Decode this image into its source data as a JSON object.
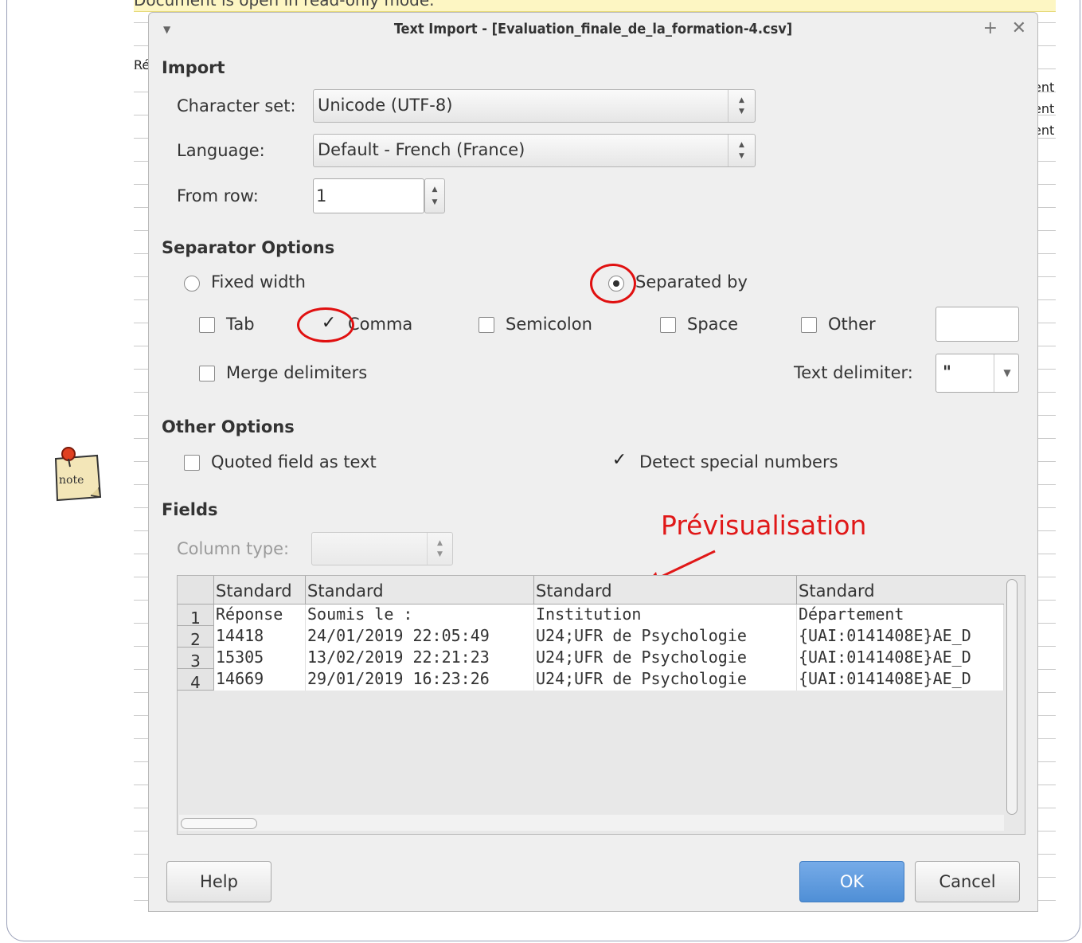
{
  "background": {
    "notice_text": "Document is open in read-only mode.",
    "left_cell": "Ré",
    "right_cells": [
      "ent",
      "ent",
      "ent"
    ],
    "note_icon_label": "note"
  },
  "dialog": {
    "title": "Text Import - [Evaluation_finale_de_la_formation-4.csv]",
    "import": {
      "section_title": "Import",
      "charset_label": "Character set:",
      "charset_value": "Unicode (UTF-8)",
      "language_label": "Language:",
      "language_value": "Default - French (France)",
      "from_row_label": "From row:",
      "from_row_value": "1"
    },
    "separator": {
      "section_title": "Separator Options",
      "fixed_width": "Fixed width",
      "separated_by": "Separated by",
      "tab": "Tab",
      "comma": "Comma",
      "semicolon": "Semicolon",
      "space": "Space",
      "other": "Other",
      "merge": "Merge delimiters",
      "text_delim_label": "Text delimiter:",
      "text_delim_value": "\""
    },
    "other_options": {
      "section_title": "Other Options",
      "quoted": "Quoted field as text",
      "detect": "Detect special numbers"
    },
    "fields": {
      "section_title": "Fields",
      "column_type_label": "Column type:",
      "annotation": "Prévisualisation",
      "headers": [
        "Standard",
        "Standard",
        "Standard",
        "Standard"
      ],
      "rows": [
        {
          "num": "1",
          "cells": [
            "Réponse",
            "Soumis le :",
            "Institution",
            "Département"
          ]
        },
        {
          "num": "2",
          "cells": [
            "14418",
            "24/01/2019 22:05:49",
            "U24;UFR de Psychologie",
            "{UAI:0141408E}AE_D"
          ]
        },
        {
          "num": "3",
          "cells": [
            "15305",
            "13/02/2019 22:21:23",
            "U24;UFR de Psychologie",
            "{UAI:0141408E}AE_D"
          ]
        },
        {
          "num": "4",
          "cells": [
            "14669",
            "29/01/2019 16:23:26",
            "U24;UFR de Psychologie",
            "{UAI:0141408E}AE_D"
          ]
        }
      ]
    },
    "buttons": {
      "help": "Help",
      "ok": "OK",
      "cancel": "Cancel"
    }
  }
}
